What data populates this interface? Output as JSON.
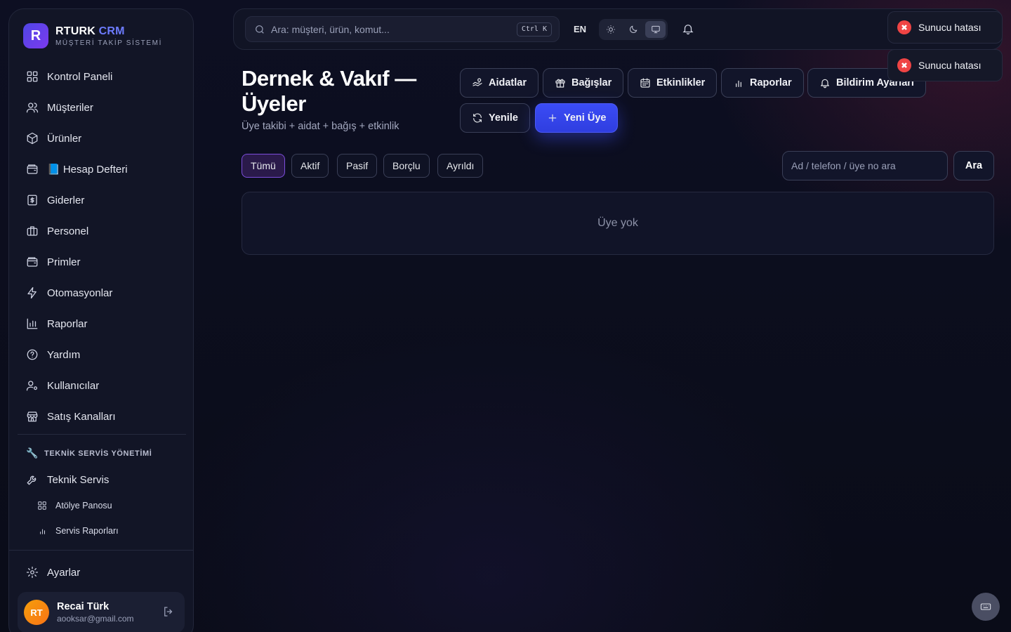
{
  "brand": {
    "name": "RTURK",
    "accent": "CRM",
    "subtitle": "MÜŞTERİ TAKİP SİSTEMİ",
    "logo_letter": "R"
  },
  "sidebar": {
    "items": [
      {
        "label": "Kontrol Paneli",
        "icon": "dashboard-icon"
      },
      {
        "label": "Müşteriler",
        "icon": "users-icon"
      },
      {
        "label": "Ürünler",
        "icon": "box-icon"
      },
      {
        "label": "📘 Hesap Defteri",
        "icon": "wallet-icon"
      },
      {
        "label": "Giderler",
        "icon": "receipt-icon"
      },
      {
        "label": "Personel",
        "icon": "briefcase-icon"
      },
      {
        "label": "Primler",
        "icon": "wallet-icon"
      },
      {
        "label": "Otomasyonlar",
        "icon": "lightning-icon"
      },
      {
        "label": "Raporlar",
        "icon": "bar-chart-icon"
      },
      {
        "label": "Yardım",
        "icon": "help-icon"
      },
      {
        "label": "Kullanıcılar",
        "icon": "user-gear-icon"
      },
      {
        "label": "Satış Kanalları",
        "icon": "store-icon"
      }
    ],
    "section_title": "TEKNİK SERVİS YÖNETİMİ",
    "service_item": "Teknik Servis",
    "sub_items": [
      {
        "label": "Atölye Panosu",
        "icon": "grid-icon"
      },
      {
        "label": "Servis Raporları",
        "icon": "bar-chart-icon"
      }
    ],
    "settings": "Ayarlar",
    "user": {
      "initials": "RT",
      "name": "Recai Türk",
      "email": "aooksar@gmail.com"
    }
  },
  "topbar": {
    "search_placeholder": "Ara: müşteri, ürün, komut...",
    "shortcut": "Ctrl K",
    "language": "EN"
  },
  "main": {
    "title": "Dernek & Vakıf — Üyeler",
    "subtitle": "Üye takibi + aidat + bağış + etkinlik",
    "actions": {
      "dues": "Aidatlar",
      "donations": "Bağışlar",
      "events": "Etkinlikler",
      "reports": "Raporlar",
      "notifications": "Bildirim Ayarları",
      "refresh": "Yenile",
      "new_member": "Yeni Üye"
    },
    "filters": [
      "Tümü",
      "Aktif",
      "Pasif",
      "Borçlu",
      "Ayrıldı"
    ],
    "member_search_placeholder": "Ad / telefon / üye no ara",
    "search_button": "Ara",
    "empty": "Üye yok"
  },
  "toasts": [
    "Sunucu hatası",
    "Sunucu hatası"
  ],
  "colors": {
    "accent": "#3b4cf5",
    "error": "#ef4444",
    "active_filter": "#7c4ddb"
  }
}
